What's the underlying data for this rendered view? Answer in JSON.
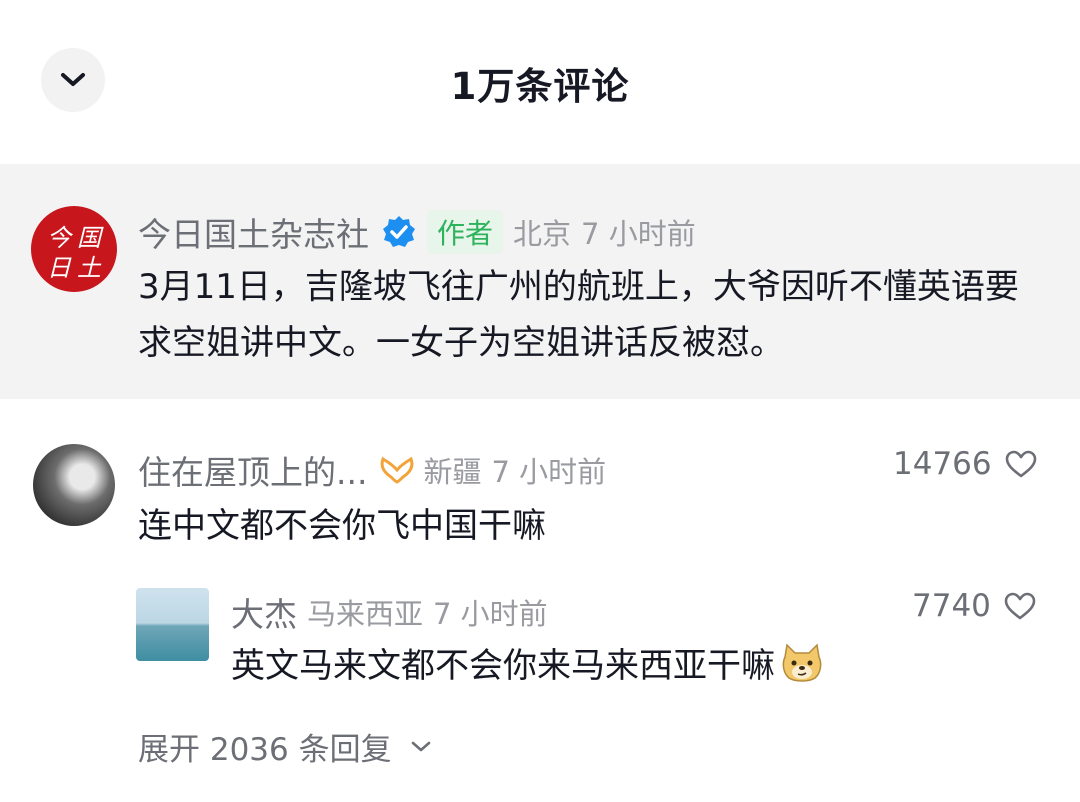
{
  "header": {
    "title": "1万条评论",
    "collapse_icon": "chevron-down-icon"
  },
  "pinned_comment": {
    "username": "今日国土杂志社",
    "verified_icon": "verified-badge-icon",
    "author_badge": "作者",
    "location": "北京",
    "time": "7 小时前",
    "text": "3月11日，吉隆坡飞往广州的航班上，大爷因听不懂英语要求空姐讲中文。一女子为空姐讲话反被怼。",
    "avatar_text": [
      "今",
      "国",
      "日",
      "土"
    ]
  },
  "comment": {
    "username": "住在屋顶上的...",
    "medal_icon": "medal-icon",
    "location": "新疆",
    "time": "7 小时前",
    "text": "连中文都不会你飞中国干嘛",
    "likes": "14766",
    "like_icon": "heart-outline-icon"
  },
  "reply": {
    "username": "大杰",
    "location": "马来西亚",
    "time": "7 小时前",
    "text": "英文马来文都不会你来马来西亚干嘛",
    "emoji_icon": "doge-emoji-icon",
    "likes": "7740",
    "like_icon": "heart-outline-icon"
  },
  "expand": {
    "label": "展开 2036 条回复",
    "icon": "chevron-down-icon"
  },
  "colors": {
    "accent_blue": "#1d8ff0",
    "author_green": "#2db35c",
    "logo_red": "#c8161d",
    "muted_text": "#6d6f76"
  }
}
